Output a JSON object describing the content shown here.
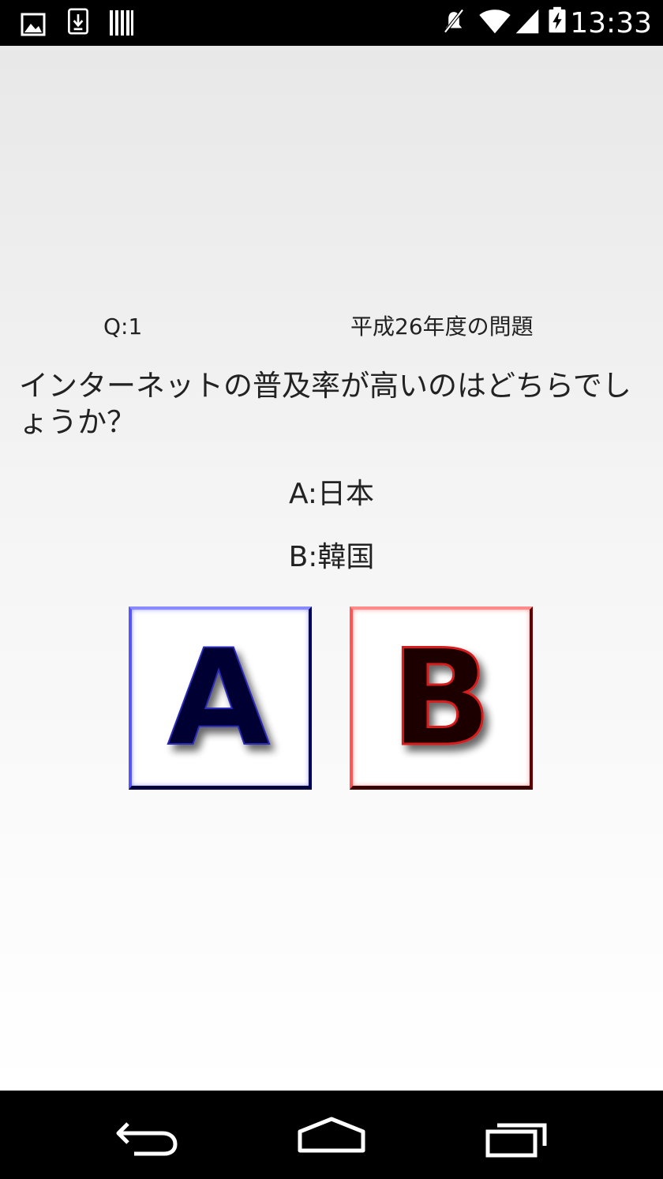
{
  "status_bar": {
    "time": "13:33",
    "icons": [
      "image-notification-icon",
      "download-notification-icon",
      "barcode-notification-icon",
      "mute-icon",
      "wifi-icon",
      "signal-icon",
      "battery-charging-icon"
    ]
  },
  "quiz": {
    "question_number": "Q:1",
    "year_label": "平成26年度の問題",
    "question_text": "インターネットの普及率が高いのはどちらでしょうか？",
    "choice_a": "A:日本",
    "choice_b": "B:韓国",
    "button_a_label": "A",
    "button_b_label": "B",
    "button_a_color": "#000060",
    "button_b_color": "#600000"
  },
  "nav_bar": {
    "icons": [
      "back-icon",
      "home-icon",
      "recents-icon"
    ]
  }
}
